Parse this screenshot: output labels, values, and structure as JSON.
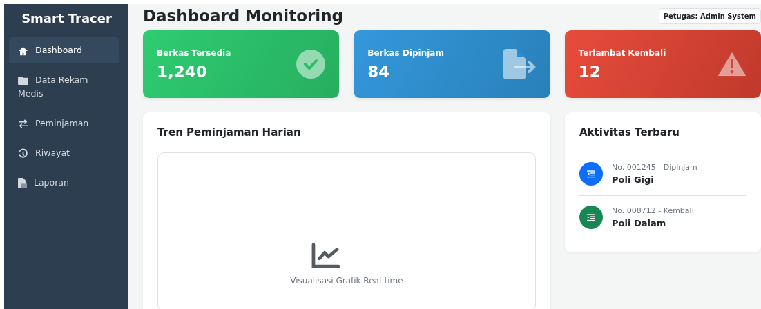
{
  "sidebar": {
    "brand": "Smart Tracer",
    "items": [
      {
        "label": "Dashboard",
        "selected": true
      },
      {
        "label": "Data Rekam Medis",
        "selected": false
      },
      {
        "label": "Peminjaman",
        "selected": false
      },
      {
        "label": "Riwayat",
        "selected": false
      },
      {
        "label": "Laporan",
        "selected": false
      }
    ]
  },
  "header": {
    "title": "Dashboard Monitoring",
    "user_badge": "Petugas: Admin System"
  },
  "stat_cards": [
    {
      "label": "Berkas Tersedia",
      "value": "1,240",
      "kind": "success"
    },
    {
      "label": "Berkas Dipinjam",
      "value": "84",
      "kind": "loan"
    },
    {
      "label": "Terlambat Kembali",
      "value": "12",
      "kind": "warning"
    }
  ],
  "chart_panel": {
    "title": "Tren Peminjaman Harian",
    "placeholder": "Visualisasi Grafik Real-time"
  },
  "activity_panel": {
    "title": "Aktivitas Terbaru",
    "items": [
      {
        "meta": "No. 001245 - Dipinjam",
        "place": "Poli Gigi",
        "color": "#0d6efd",
        "kind": "out"
      },
      {
        "meta": "No. 008712 - Kembali",
        "place": "Poli Dalam",
        "color": "#198754",
        "kind": "in"
      }
    ]
  }
}
